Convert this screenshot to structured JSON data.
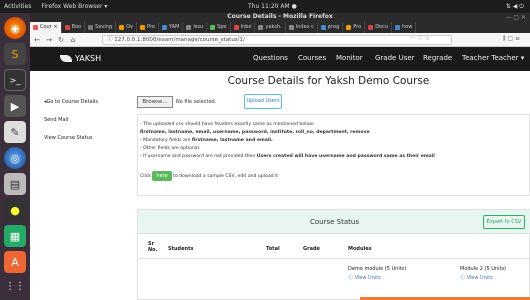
{
  "os": {
    "activities": "Activities",
    "app_menu": "Firefox Web Browser ▾",
    "clock": "Thu 11:20 AM ●",
    "tray": "⇅ ◀ ⏻"
  },
  "browser": {
    "window_title": "Course Details - Mozilla Firefox",
    "tabs": [
      {
        "label": "Cour ×",
        "color": "#e55",
        "active": true
      },
      {
        "label": "Boo",
        "color": "#c44"
      },
      {
        "label": "Saving",
        "color": "#777"
      },
      {
        "label": "Ov",
        "color": "#e90"
      },
      {
        "label": "Pro",
        "color": "#e90"
      },
      {
        "label": "YAM",
        "color": "#48c"
      },
      {
        "label": "Issu",
        "color": "#888"
      },
      {
        "label": "Spo",
        "color": "#5b5"
      },
      {
        "label": "Inbo",
        "color": "#d44"
      },
      {
        "label": "yaksh.",
        "color": "#888"
      },
      {
        "label": "Index c",
        "color": "#888"
      },
      {
        "label": "prog",
        "color": "#48c"
      },
      {
        "label": "Pro",
        "color": "#e90"
      },
      {
        "label": "Docu",
        "color": "#c44"
      },
      {
        "label": "how",
        "color": "#48c"
      }
    ],
    "window_controls": "— ▢ ×",
    "url": "127.0.0.1:8000/exam/manage/course_status/1/",
    "url_extras": "··· ♡ ☆",
    "toolbar_right": "⫼ ▢ ≡"
  },
  "navbar": {
    "brand": "YAKSH",
    "links": [
      "Questions",
      "Courses",
      "Monitor",
      "Grade User",
      "Regrade",
      "Teacher Teacher ▾"
    ]
  },
  "sidebar": {
    "items": [
      "◂Go to Course Details",
      "Send Mail",
      "View Course Status"
    ]
  },
  "main": {
    "title": "Course Details for Yaksh Demo Course",
    "browse_label": "Browse...",
    "no_file_label": "No file selected.",
    "upload_label": "Upload Users",
    "info": {
      "line1": "- The uploaded csv should have headers exactly same as mentioned below:",
      "line2": "firstname, lastname, email, username, password, institute, roll_no, department, remove",
      "line3_pre": "- Mandatory fields are ",
      "line3_bold": "firstname, lastname and email.",
      "line4": "- Other fields are optional.",
      "line5_pre": "- If username and password are not provided then ",
      "line5_bold": "Users created will have username and password same as their email",
      "click_pre": "Click",
      "here_label": "here",
      "click_post": "to download a sample CSV, edit and upload it"
    },
    "status": {
      "title": "Course Status",
      "export_label": "Export to CSV",
      "headers": [
        "Sr No.",
        "Students",
        "Total",
        "Grade",
        "Modules"
      ],
      "modules": [
        {
          "name": "Demo module (5 Units)",
          "view": "ⓘ View Units"
        },
        {
          "name": "Module 2 (5 Units)",
          "view": "ⓘ View Units"
        }
      ]
    }
  }
}
